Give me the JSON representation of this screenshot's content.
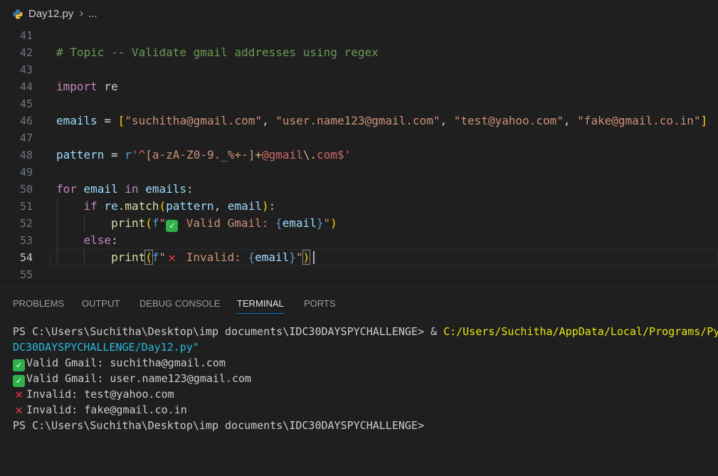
{
  "breadcrumb": {
    "file": "Day12.py",
    "separator": "›",
    "more": "..."
  },
  "editor": {
    "line_numbers": [
      "41",
      "42",
      "43",
      "44",
      "45",
      "46",
      "47",
      "48",
      "49",
      "50",
      "51",
      "52",
      "53",
      "54",
      "55"
    ],
    "active_line": "54",
    "code": {
      "l42_comment": "# Topic -- Validate gmail addresses using regex",
      "l44_import": "import",
      "l44_module": " re",
      "l46_var": "emails",
      "l46_eq": " = ",
      "l46_s1": "\"suchitha@gmail.com\"",
      "l46_s2": "\"user.name123@gmail.com\"",
      "l46_s3": "\"test@yahoo.com\"",
      "l46_s4": "\"fake@gmail.co.in\"",
      "l46_sep": ", ",
      "l48_var": "pattern",
      "l48_eq": " = ",
      "l48_prefix": "r",
      "l48_q": "'",
      "l48_caret": "^",
      "l48_class": "[a-zA-Z0-9._%+-]",
      "l48_plus": "+",
      "l48_lit1": "@gmail",
      "l48_esc": "\\.",
      "l48_lit2": "com",
      "l48_dollar": "$",
      "l50_for": "for",
      "l50_email": " email ",
      "l50_in": "in",
      "l50_emails": " emails",
      "l50_colon": ":",
      "l51_if": "if",
      "l51_re": " re",
      "l51_dot": ".",
      "l51_match": "match",
      "l51_args_a": "pattern",
      "l51_args_sep": ", ",
      "l51_args_b": "email",
      "l51_colon": ":",
      "l52_print": "print",
      "l52_f": "f",
      "l52_q": "\"",
      "l52_text": " Valid Gmail: ",
      "l52_var": "email",
      "l53_else": "else",
      "l53_colon": ":",
      "l54_print": "print",
      "l54_f": "f",
      "l54_q": "\"",
      "l54_text": " Invalid: ",
      "l54_var": "email"
    }
  },
  "panel": {
    "tabs": [
      "PROBLEMS",
      "OUTPUT",
      "DEBUG CONSOLE",
      "TERMINAL",
      "PORTS"
    ],
    "active_tab": "TERMINAL",
    "terminal": {
      "prompt_path": "PS C:\\Users\\Suchitha\\Desktop\\imp documents\\IDC30DAYSPYCHALLENGE> ",
      "amp": "& ",
      "python_path": "C:/Users/Suchitha/AppData/Local/Programs/Py",
      "script_tail": "DC30DAYSPYCHALLENGE/Day12.py\"",
      "outputs": [
        "Valid Gmail: suchitha@gmail.com",
        "Valid Gmail: user.name123@gmail.com",
        "Invalid: test@yahoo.com",
        "Invalid: fake@gmail.co.in"
      ],
      "final_prompt": "PS C:\\Users\\Suchitha\\Desktop\\imp documents\\IDC30DAYSPYCHALLENGE>"
    }
  },
  "colors": {
    "background": "#1f1f1f",
    "accent": "#0078d4",
    "check": "#2fb24c",
    "cross": "#e8364f"
  },
  "icons": {
    "file_type": "python-icon",
    "valid": "check-mark-icon",
    "invalid": "cross-mark-icon"
  }
}
